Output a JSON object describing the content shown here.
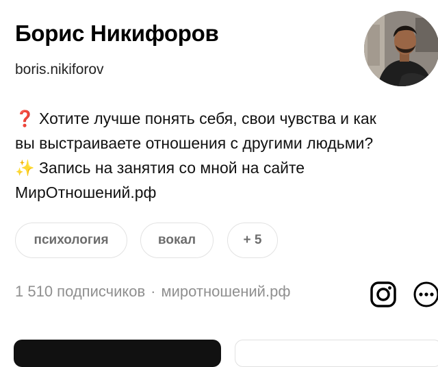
{
  "profile": {
    "name": "Борис Никифоров",
    "username": "boris.nikiforov",
    "bio": {
      "line1_emoji": "❓",
      "line1_text": "Хотите лучше понять себя, свои чувства и как",
      "line2_text": "вы выстраиваете отношения с другими людьми?",
      "line3_emoji": "✨",
      "line3_text": "Запись на занятия со мной на сайте",
      "line4_text": "МирОтношений.рф"
    }
  },
  "tags": [
    "психология",
    "вокал",
    "+ 5"
  ],
  "stats": {
    "followers": "1 510 подписчиков",
    "separator": "·",
    "website": "миротношений.рф"
  },
  "icons": {
    "instagram": "instagram-icon",
    "more": "more-icon"
  },
  "colors": {
    "text": "#000000",
    "muted": "#8f8f8f",
    "tag_border": "#e2e2e2",
    "tag_text": "#6d6d6d",
    "primary_button": "#111111"
  }
}
